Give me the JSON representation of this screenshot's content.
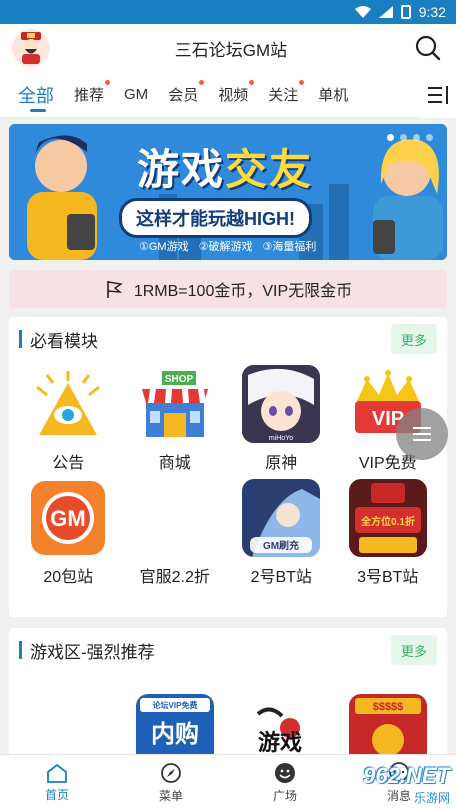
{
  "status": {
    "time": "9:32"
  },
  "header": {
    "title": "三石论坛GM站"
  },
  "tabs": [
    {
      "label": "全部",
      "active": true,
      "dot": false
    },
    {
      "label": "推荐",
      "dot": true
    },
    {
      "label": "GM",
      "dot": false
    },
    {
      "label": "会员",
      "dot": true
    },
    {
      "label": "视频",
      "dot": true
    },
    {
      "label": "关注",
      "dot": true
    },
    {
      "label": "单机",
      "dot": false
    }
  ],
  "banner": {
    "title_a": "游戏",
    "title_b": "交友",
    "subtitle": "这样才能玩越HIGH!",
    "tags": [
      "①GM游戏",
      "②破解游戏",
      "③海量福利"
    ]
  },
  "notice": {
    "text": "1RMB=100金币，VIP无限金币"
  },
  "section1": {
    "title": "必看模块",
    "more": "更多",
    "items": [
      {
        "label": "公告",
        "icon": "eye-pyramid-icon"
      },
      {
        "label": "商城",
        "icon": "shop-icon",
        "badge": "SHOP"
      },
      {
        "label": "原神",
        "icon": "genshin-icon",
        "caption": "miHoYo"
      },
      {
        "label": "VIP免费",
        "icon": "vip-crown-icon",
        "badge": "VIP"
      },
      {
        "label": "20包站",
        "icon": "gm-badge-icon",
        "badge": "GM"
      },
      {
        "label": "官服2.2折",
        "icon": "blank-icon"
      },
      {
        "label": "2号BT站",
        "icon": "bt-game-icon",
        "caption": "GM刷充"
      },
      {
        "label": "3号BT站",
        "icon": "bt-card-icon",
        "caption": "全方位0.1折"
      }
    ]
  },
  "section2": {
    "title": "游戏区-强烈推荐",
    "more": "更多",
    "items": [
      {
        "label": "",
        "icon": "blank-icon"
      },
      {
        "label": "内购",
        "icon": "neigou-icon",
        "caption": "论坛VIP免费"
      },
      {
        "label": "游戏",
        "icon": "game-calligraphy-icon"
      },
      {
        "label": "$$$$$",
        "icon": "cash-icon"
      }
    ]
  },
  "bottomnav": [
    {
      "label": "首页",
      "icon": "home-icon",
      "active": true
    },
    {
      "label": "菜单",
      "icon": "compass-icon"
    },
    {
      "label": "广场",
      "icon": "smile-icon"
    },
    {
      "label": "消息",
      "icon": "message-icon"
    }
  ],
  "watermark": {
    "big": "962.NET",
    "small": "乐游网"
  },
  "colors": {
    "accent": "#1a7fc1",
    "more_bg": "#e4f6ea",
    "more_fg": "#38b36b",
    "notice_bg": "#f8e1e4"
  }
}
